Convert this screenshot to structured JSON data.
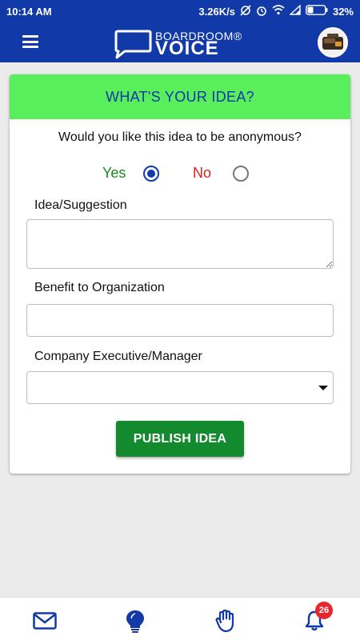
{
  "status_bar": {
    "time": "10:14 AM",
    "network_speed": "3.26K/s",
    "battery_percent": "32%"
  },
  "app_bar": {
    "brand_top": "BOARDROOM®",
    "brand_bottom": "VOICE"
  },
  "form": {
    "title": "WHAT'S YOUR IDEA?",
    "anonymous_question": "Would you like this idea to be anonymous?",
    "yes_label": "Yes",
    "no_label": "No",
    "selected_option": "Yes",
    "idea_label": "Idea/Suggestion",
    "idea_value": "",
    "benefit_label": "Benefit to Organization",
    "benefit_value": "",
    "exec_label": "Company Executive/Manager",
    "exec_selected": "",
    "publish_label": "PUBLISH IDEA"
  },
  "bottom_nav": {
    "items": [
      {
        "icon": "mail-icon"
      },
      {
        "icon": "lightbulb-icon"
      },
      {
        "icon": "raised-hand-icon"
      },
      {
        "icon": "bell-icon"
      }
    ],
    "notification_count": "26"
  },
  "colors": {
    "primary": "#1239a8",
    "header_green": "#59ee5c",
    "publish_green": "#138a2e",
    "yes_green": "#1a8a1a",
    "no_red": "#e01e1e",
    "badge_red": "#e8262e"
  }
}
